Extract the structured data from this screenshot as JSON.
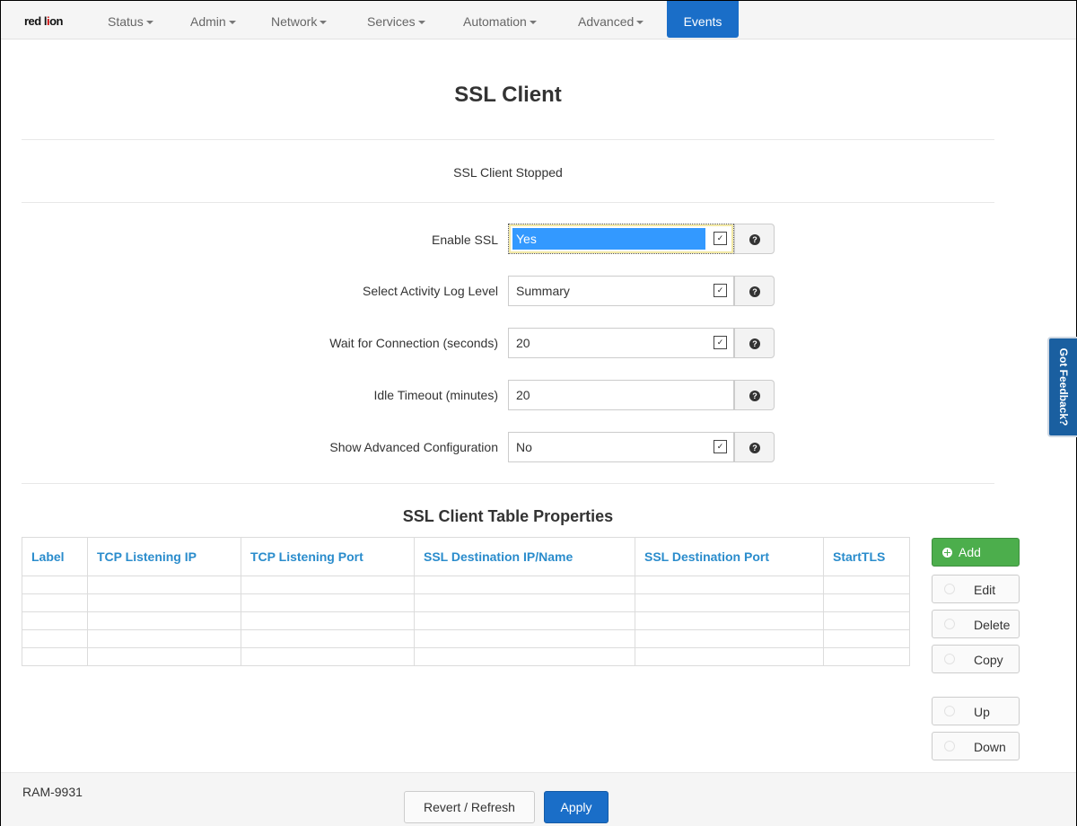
{
  "nav": {
    "logo_text_1": "red l",
    "logo_text_2": "i",
    "logo_text_3": "on",
    "items": [
      {
        "label": "Status"
      },
      {
        "label": "Admin"
      },
      {
        "label": "Network"
      },
      {
        "label": "Services"
      },
      {
        "label": "Automation"
      },
      {
        "label": "Advanced"
      }
    ],
    "active_label": "Events"
  },
  "page": {
    "title": "SSL Client",
    "status": "SSL Client Stopped"
  },
  "form": {
    "enable_ssl": {
      "label": "Enable SSL",
      "value": "Yes"
    },
    "log_level": {
      "label": "Select Activity Log Level",
      "value": "Summary"
    },
    "wait_connection": {
      "label": "Wait for Connection (seconds)",
      "value": "20"
    },
    "idle_timeout": {
      "label": "Idle Timeout (minutes)",
      "value": "20"
    },
    "advanced_config": {
      "label": "Show Advanced Configuration",
      "value": "No"
    }
  },
  "table": {
    "title": "SSL Client Table Properties",
    "columns": [
      "Label",
      "TCP Listening IP",
      "TCP Listening Port",
      "SSL Destination IP/Name",
      "SSL Destination Port",
      "StartTLS"
    ],
    "rows": [
      [
        "",
        "",
        "",
        "",
        "",
        ""
      ],
      [
        "",
        "",
        "",
        "",
        "",
        ""
      ],
      [
        "",
        "",
        "",
        "",
        "",
        ""
      ],
      [
        "",
        "",
        "",
        "",
        "",
        ""
      ],
      [
        "",
        "",
        "",
        "",
        "",
        ""
      ]
    ]
  },
  "actions": {
    "add": "Add",
    "edit": "Edit",
    "delete": "Delete",
    "copy": "Copy",
    "up": "Up",
    "down": "Down"
  },
  "feedback_label": "Got Feedback?",
  "footer": {
    "device": "RAM-9931",
    "revert": "Revert / Refresh",
    "apply": "Apply"
  },
  "colors": {
    "accent": "#1a6ec8",
    "add_button": "#4cae4c",
    "table_header": "#2a8ccc",
    "selection": "#3399ff"
  }
}
